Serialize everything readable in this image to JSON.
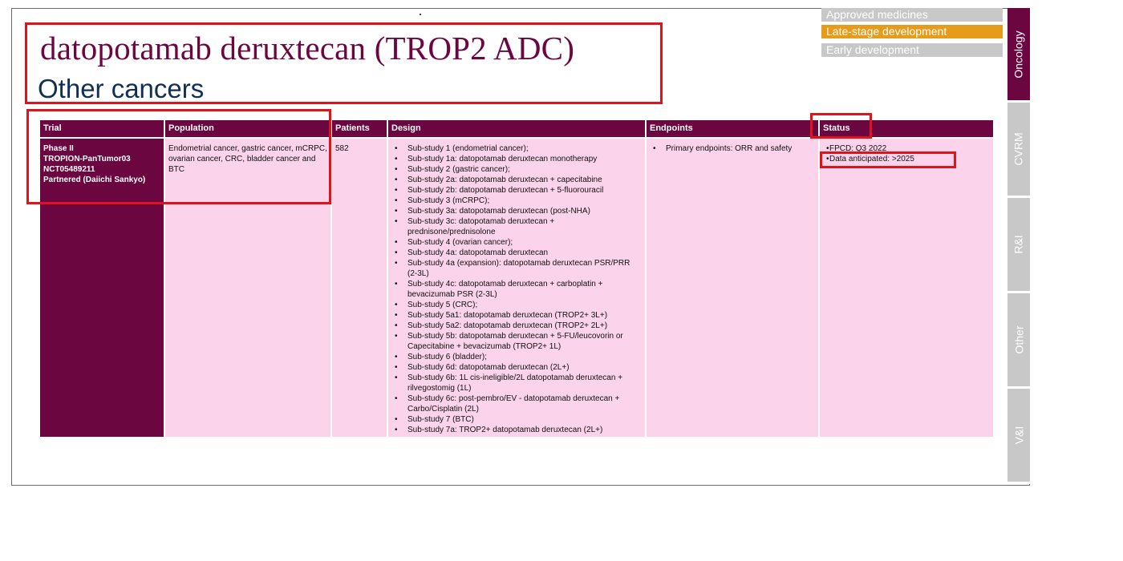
{
  "title": "datopotamab deruxtecan (TROP2 ADC)",
  "subtitle": "Other cancers",
  "legend": {
    "approved": "Approved medicines",
    "late": "Late-stage development",
    "early": "Early development"
  },
  "tabs": [
    "Oncology",
    "CVRM",
    "R&I",
    "Other",
    "V&I"
  ],
  "colors": {
    "brand": "#6b0640",
    "late_stage": "#e69b1a",
    "cell_bg": "#fbd3ea",
    "highlight": "#e0131a"
  },
  "table": {
    "headers": [
      "Trial",
      "Population",
      "Patients",
      "Design",
      "Endpoints",
      "Status"
    ],
    "row": {
      "trial": [
        "Phase II",
        "TROPION-PanTumor03",
        "NCT05489211",
        "Partnered (Daiichi Sankyo)"
      ],
      "population": "Endometrial cancer, gastric cancer, mCRPC, ovarian cancer, CRC, bladder cancer and BTC",
      "patients": "582",
      "design": [
        "Sub-study 1 (endometrial cancer);",
        "Sub-study 1a: datopotamab deruxtecan monotherapy",
        "Sub-study 2 (gastric cancer);",
        "Sub-study 2a: datopotamab deruxtecan + capecitabine",
        "Sub-study 2b: datopotamab deruxtecan + 5-fluorouracil",
        "Sub-study 3 (mCRPC);",
        "Sub-study 3a: datopotamab deruxtecan (post-NHA)",
        "Sub-study 3c: datopotamab deruxtecan + prednisone/prednisolone",
        "Sub-study 4 (ovarian cancer);",
        "Sub-study 4a: datopotamab deruxtecan",
        "Sub-study 4a (expansion): datopotamab deruxtecan PSR/PRR (2-3L)",
        "Sub-study 4c: datopotamab deruxtecan + carboplatin + bevacizumab PSR (2-3L)",
        "Sub-study 5 (CRC);",
        "Sub-study 5a1: datopotamab deruxtecan (TROP2+ 3L+)",
        "Sub-study 5a2: datopotamab deruxtecan (TROP2+ 2L+)",
        "Sub-study 5b: datopotamab deruxtecan + 5-FU/leucovorin or Capecitabine + bevacizumab (TROP2+ 1L)",
        "Sub-study 6 (bladder);",
        "Sub-study 6d: datopotamab deruxtecan (2L+)",
        "Sub-study 6b: 1L cis-ineligible/2L datopotamab deruxtecan + rilvegostomig (1L)",
        "Sub-study 6c: post-pembro/EV - datopotamab deruxtecan + Carbo/Cisplatin (2L)",
        "Sub-study 7 (BTC)",
        "Sub-study 7a: TROP2+ datopotamab deruxtecan (2L+)"
      ],
      "endpoints": [
        "Primary endpoints: ORR and safety"
      ],
      "status": [
        "FPCD: Q3 2022",
        "Data anticipated: >2025"
      ]
    }
  }
}
